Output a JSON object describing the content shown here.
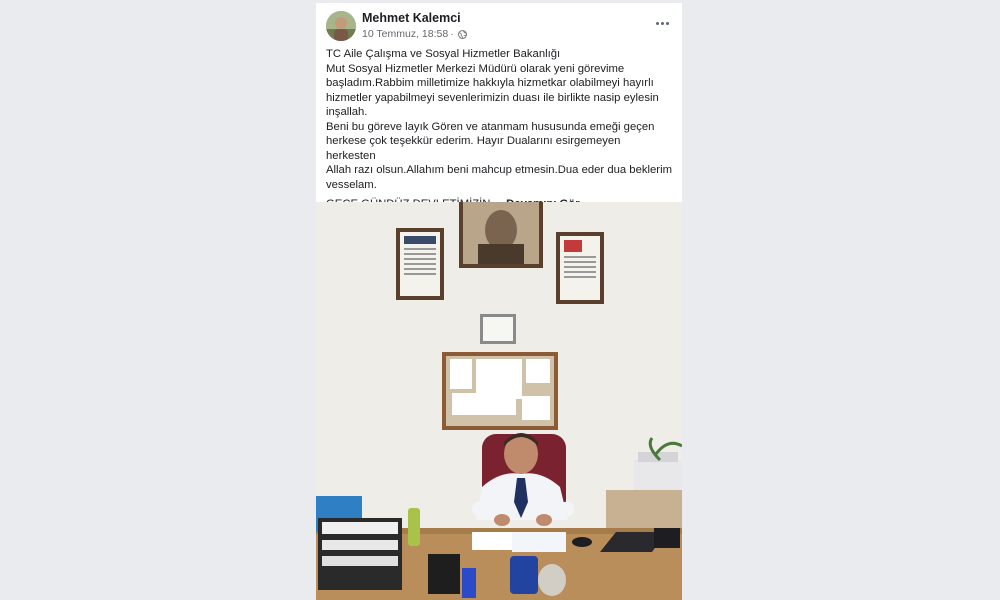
{
  "post": {
    "author": "Mehmet Kalemci",
    "timestamp": "10 Temmuz, 18:58",
    "separator": "·",
    "lines": [
      "TC Aile Çalışma ve Sosyal Hizmetler Bakanlığı",
      "Mut Sosyal Hizmetler Merkezi Müdürü olarak yeni görevime",
      "başladım.Rabbim milletimize hakkıyla hizmetkar olabilmeyi hayırlı",
      "hizmetler yapabilmeyi sevenlerimizin duası ile birlikte nasip eylesin",
      "inşallah.",
      "Beni bu göreve layık Gören ve atanmam hususunda emeği geçen",
      "herkese çok teşekkür ederim. Hayır Dualarını esirgemeyen herkesten",
      "Allah razı olsun.Allahım beni mahcup etmesin.Dua eder dua beklerim",
      "vesselam."
    ],
    "teaser": "GECE GÜNDÜZ DEVLETİMİZİN ...",
    "see_more": "Devamını Gör"
  },
  "icons": {
    "more": "more-options-icon",
    "privacy": "globe-icon"
  },
  "colors": {
    "background": "#e9ebee",
    "card": "#ffffff",
    "text": "#1c1e21",
    "meta": "#65676b"
  }
}
